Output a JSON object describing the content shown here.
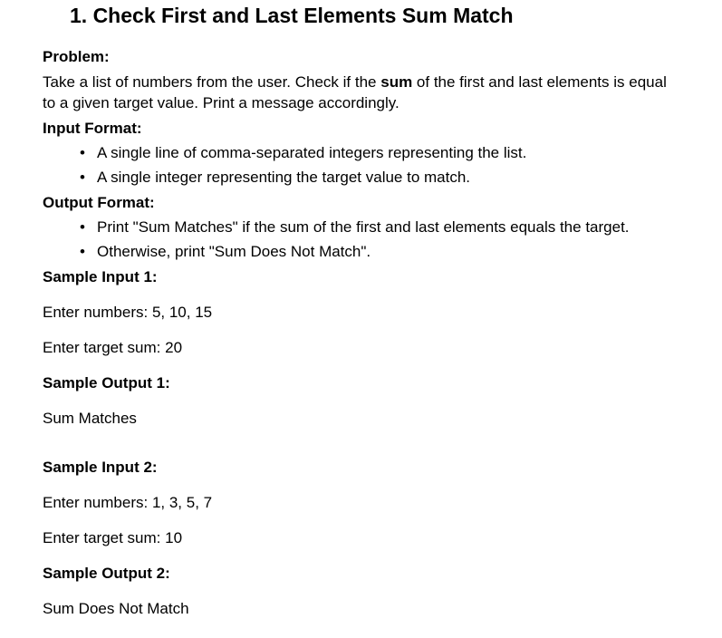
{
  "title": "1. Check First and Last Elements Sum Match",
  "problem_label": "Problem:",
  "problem_line1_pre": "Take a list of numbers from the user. Check if the ",
  "problem_bold": "sum",
  "problem_line1_post": " of the first and last elements is equal",
  "problem_line2": "to a given target value. Print a message accordingly.",
  "input_label": "Input Format:",
  "input_items": [
    "A single line of comma-separated integers representing the list.",
    "A single integer representing the target value to match."
  ],
  "output_label": "Output Format:",
  "output_items": [
    "Print \"Sum Matches\" if the sum of the first and last elements equals the target.",
    "Otherwise, print \"Sum Does Not Match\"."
  ],
  "samples": [
    {
      "in_label": "Sample Input 1:",
      "numbers": "Enter numbers: 5, 10, 15",
      "target": "Enter target sum: 20",
      "out_label": "Sample Output 1:",
      "output": "Sum Matches"
    },
    {
      "in_label": "Sample Input 2:",
      "numbers": "Enter numbers: 1, 3, 5, 7",
      "target": "Enter target sum: 10",
      "out_label": "Sample Output 2:",
      "output": "Sum Does Not Match"
    }
  ]
}
